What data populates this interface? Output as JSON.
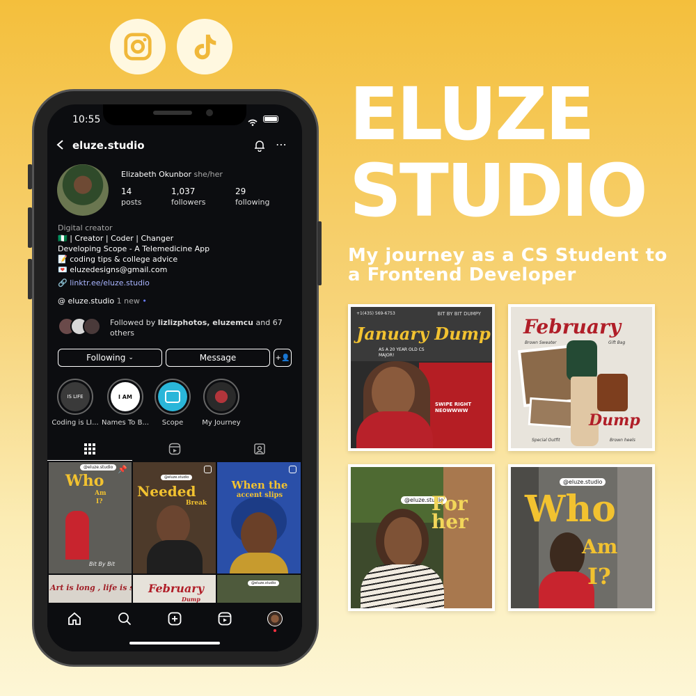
{
  "brand": {
    "line1": "ELUZE",
    "line2": "STUDIO"
  },
  "tagline": "My journey as a CS Student to a Frontend Developer",
  "social_icons": [
    "instagram-icon",
    "tiktok-icon"
  ],
  "colors": {
    "accent": "#f4bf3c",
    "yellow_text": "#f2c230",
    "red": "#c9242b"
  },
  "thumbnails": {
    "january": {
      "top": "+1(435) 569-6753",
      "topright": "BIT BY BIT DUMPY",
      "title": "January Dump",
      "sub": "AS A 20 YEAR OLD CS MAJOR!",
      "swipe": "SWIPE RIGHT NEOWWWW"
    },
    "february": {
      "title": "February",
      "dump": "Dump",
      "note1": "Brown Sweater",
      "note2": "Gift Bag",
      "note3": "Special Outfit",
      "note4": "Brown heels"
    },
    "forher": {
      "tag": "@eluze.studio",
      "title": "For her"
    },
    "whoami": {
      "tag": "@eluze.studio",
      "w1": "Who",
      "w2": "Am",
      "w3": "I?"
    }
  },
  "phone": {
    "time": "10:55",
    "username": "eluze.studio",
    "name": "Elizabeth Okunbor",
    "pronouns": "she/her",
    "stats": [
      {
        "value": "14",
        "label": "posts"
      },
      {
        "value": "1,037",
        "label": "followers"
      },
      {
        "value": "29",
        "label": "following"
      }
    ],
    "category": "Digital creator",
    "bio": [
      "🇳🇬 | Creator | Coder | Changer",
      "Developing Scope - A Telemedicine App",
      "📝 coding tips & college advice",
      "💌 eluzedesigns@gmail.com"
    ],
    "link": "linktr.ee/eluze.studio",
    "threads_name": "eluze.studio",
    "threads_new": "1 new",
    "followed_by": "Followed by ",
    "followed_names": "lizlizphotos, eluzemcu",
    "followed_rest": " and 67 others",
    "buttons": {
      "following": "Following",
      "message": "Message"
    },
    "highlights": [
      "Coding is LI...",
      "Names To B...",
      "Scope",
      "My Journey"
    ],
    "hl_text": {
      "life": "IS LIFE",
      "name": "I AM"
    },
    "posts": [
      {
        "tag": "@eluze.studio",
        "t1": "Who",
        "t2": "Am",
        "t3": "I?",
        "foot": "Bit By Bit"
      },
      {
        "tag": "@eluze.studio",
        "t1": "Needed",
        "t2": "Break"
      },
      {
        "t1": "When the",
        "t2": "accent slips"
      },
      {
        "t1": "Art is long , life is short"
      },
      {
        "t1": "February",
        "t2": "Dump"
      },
      {
        "tag": "@eluze.studio"
      }
    ]
  }
}
